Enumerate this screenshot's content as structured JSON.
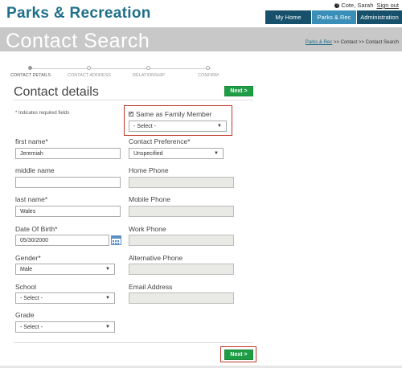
{
  "app": {
    "brand": "Parks & Recreation",
    "user_name": "Cote, Sarah",
    "sign_out": "Sign out"
  },
  "nav": {
    "my_home": "My Home",
    "parks_rec": "Parks & Rec",
    "administration": "Administration"
  },
  "header": {
    "title": "Contact Search",
    "breadcrumb_link": "Parks & Rec",
    "breadcrumb_rest": ">> Contact >> Contact Search"
  },
  "steps": [
    "CONTACT DETAILS",
    "CONTACT ADDRESS",
    "RELATIONSHIP",
    "CONFIRM"
  ],
  "form": {
    "section_title": "Contact details",
    "next_label": "Next >",
    "required_note": "* Indicates required fields",
    "same_as_family_label": "Same as Family Member",
    "same_as_family_checked": true,
    "family_member_select": "- Select -",
    "first_name_label": "first name*",
    "first_name_value": "Jeremiah",
    "contact_pref_label": "Contact Preference*",
    "contact_pref_value": "Unspecified",
    "middle_name_label": "middle name",
    "middle_name_value": "",
    "home_phone_label": "Home Phone",
    "last_name_label": "last name*",
    "last_name_value": "Wales",
    "mobile_phone_label": "Mobile Phone",
    "dob_label": "Date Of Birth*",
    "dob_value": "05/30/2000",
    "work_phone_label": "Work Phone",
    "gender_label": "Gender*",
    "gender_value": "Male",
    "alt_phone_label": "Alternative Phone",
    "school_label": "School",
    "school_value": "- Select -",
    "email_label": "Email Address",
    "grade_label": "Grade",
    "grade_value": "- Select -"
  },
  "icons": {
    "user_icon": "question-circle-icon",
    "dropdown_icon": "chevron-down-icon",
    "calendar_icon": "calendar-icon",
    "checkbox_icon": "checkbox-checked-icon"
  },
  "colors": {
    "brand": "#1f6f8b",
    "nav_dark": "#16506b",
    "nav_active": "#3a8fb8",
    "header_grey": "#c8c8c8",
    "next_green": "#1e9e44",
    "highlight_red": "#c0392b"
  }
}
